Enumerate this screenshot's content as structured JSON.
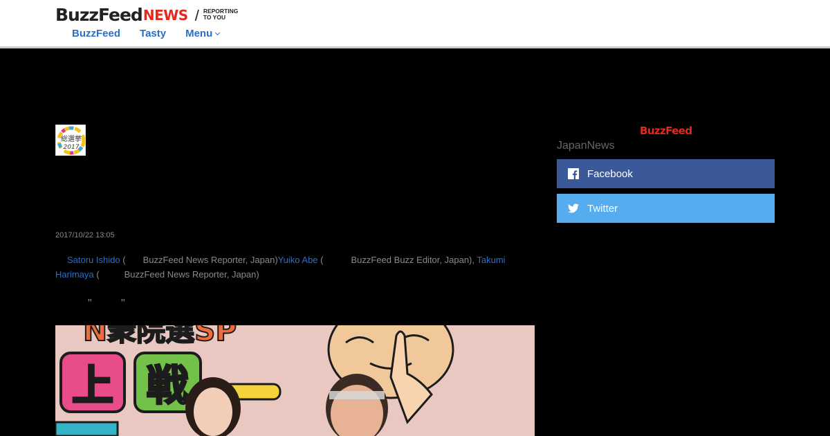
{
  "header": {
    "logo_buzzfeed": "BuzzFeed",
    "logo_news": "NEWS",
    "logo_slash": "/",
    "tagline_line1": "REPORTING",
    "tagline_line2": "TO YOU",
    "nav": [
      {
        "label": "BuzzFeed"
      },
      {
        "label": "Tasty"
      },
      {
        "label": "Menu"
      }
    ]
  },
  "article": {
    "badge_text_1": "総選挙",
    "badge_text_2": "2017",
    "date": "2017/10/22 13:05",
    "byline": {
      "authors": [
        {
          "name": "Satoru Ishido",
          "role": "BuzzFeed News Reporter, Japan"
        },
        {
          "name": "Yuiko Abe",
          "role": "BuzzFeed Buzz Editor, Japan"
        },
        {
          "name": "Takumi Harimaya",
          "role": "BuzzFeed News Reporter, Japan"
        }
      ]
    },
    "quote_open": "\"",
    "quote_close": "\"",
    "photo_text_top": "N衆院選SP",
    "photo_text_block1": "上",
    "photo_text_block2": "戦"
  },
  "sidebar": {
    "brand": "BuzzFeed",
    "title": "JapanNews",
    "facebook_label": "Facebook",
    "twitter_label": "Twitter"
  },
  "colors": {
    "link": "#2a6fc4",
    "brand_red": "#e32a1d",
    "facebook": "#3b5998",
    "twitter": "#55acee"
  }
}
